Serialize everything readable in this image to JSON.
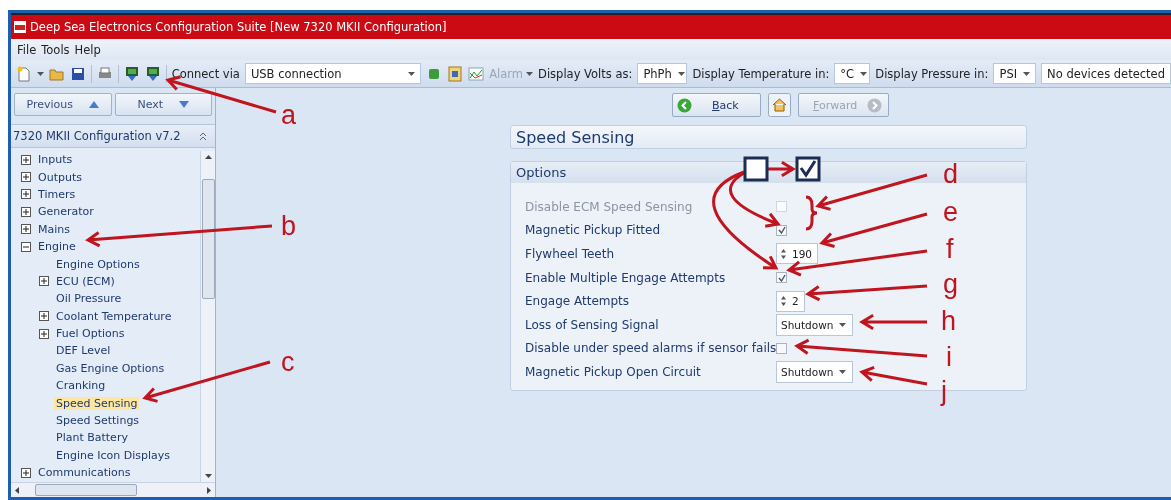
{
  "window": {
    "title": "Deep Sea Electronics Configuration Suite [New 7320 MKII Configuration]"
  },
  "menu": [
    "File",
    "Tools",
    "Help"
  ],
  "toolbar": {
    "connect_label": "Connect via",
    "connection": "USB connection",
    "alarm": "Alarm",
    "alarm_disabled": true,
    "volts_label": "Display Volts as:",
    "volts": "PhPh",
    "temperature_label": "Display Temperature in:",
    "temperature": "°C",
    "pressure_label": "Display Pressure in:",
    "pressure": "PSI",
    "status": "No devices detected"
  },
  "navigation": {
    "previous": "Previous",
    "next": "Next",
    "back": "Back",
    "forward": "Forward",
    "forward_disabled": true
  },
  "sidebar": {
    "title": "7320 MKII Configuration v7.2",
    "items": [
      {
        "label": "Inputs",
        "expanded": false,
        "selected": false
      },
      {
        "label": "Outputs",
        "expanded": false,
        "selected": false
      },
      {
        "label": "Timers",
        "expanded": false,
        "selected": false
      },
      {
        "label": "Generator",
        "expanded": false,
        "selected": false
      },
      {
        "label": "Mains",
        "expanded": false,
        "selected": false
      },
      {
        "label": "Engine",
        "expanded": true,
        "selected": false,
        "children": [
          {
            "label": "Engine Options",
            "selected": false
          },
          {
            "label": "ECU (ECM)",
            "expanded": false,
            "selected": false
          },
          {
            "label": "Oil Pressure",
            "selected": false
          },
          {
            "label": "Coolant Temperature",
            "expanded": false,
            "selected": false
          },
          {
            "label": "Fuel Options",
            "expanded": false,
            "selected": false
          },
          {
            "label": "DEF Level",
            "selected": false
          },
          {
            "label": "Gas Engine Options",
            "selected": false
          },
          {
            "label": "Cranking",
            "selected": false
          },
          {
            "label": "Speed Sensing",
            "selected": true
          },
          {
            "label": "Speed Settings",
            "selected": false
          },
          {
            "label": "Plant Battery",
            "selected": false
          },
          {
            "label": "Engine Icon Displays",
            "selected": false
          }
        ]
      },
      {
        "label": "Communications",
        "expanded": false,
        "selected": false
      }
    ]
  },
  "page": {
    "title": "Speed Sensing",
    "section": "Options",
    "options": [
      {
        "kind": "checkbox",
        "label": "Disable ECM Speed Sensing",
        "checked": false,
        "disabled": true
      },
      {
        "kind": "checkbox",
        "label": "Magnetic Pickup Fitted",
        "checked": true,
        "disabled": false
      },
      {
        "kind": "spinner",
        "label": "Flywheel Teeth",
        "value": "190",
        "disabled": false
      },
      {
        "kind": "checkbox",
        "label": "Enable Multiple Engage Attempts",
        "checked": true,
        "disabled": false
      },
      {
        "kind": "spinner",
        "label": "Engage Attempts",
        "value": "2",
        "disabled": false
      },
      {
        "kind": "dropdown",
        "label": "Loss of Sensing Signal",
        "value": "Shutdown",
        "disabled": false
      },
      {
        "kind": "checkbox",
        "label": "Disable under speed alarms if sensor fails",
        "checked": false,
        "disabled": false
      },
      {
        "kind": "dropdown",
        "label": "Magnetic Pickup Open Circuit",
        "value": "Shutdown",
        "disabled": false
      }
    ]
  },
  "annotations": [
    {
      "text": "a"
    },
    {
      "text": "b"
    },
    {
      "text": "c"
    },
    {
      "text": "d"
    },
    {
      "text": "e"
    },
    {
      "text": "f"
    },
    {
      "text": "g"
    },
    {
      "text": "h"
    },
    {
      "text": "i"
    },
    {
      "text": "j"
    }
  ]
}
